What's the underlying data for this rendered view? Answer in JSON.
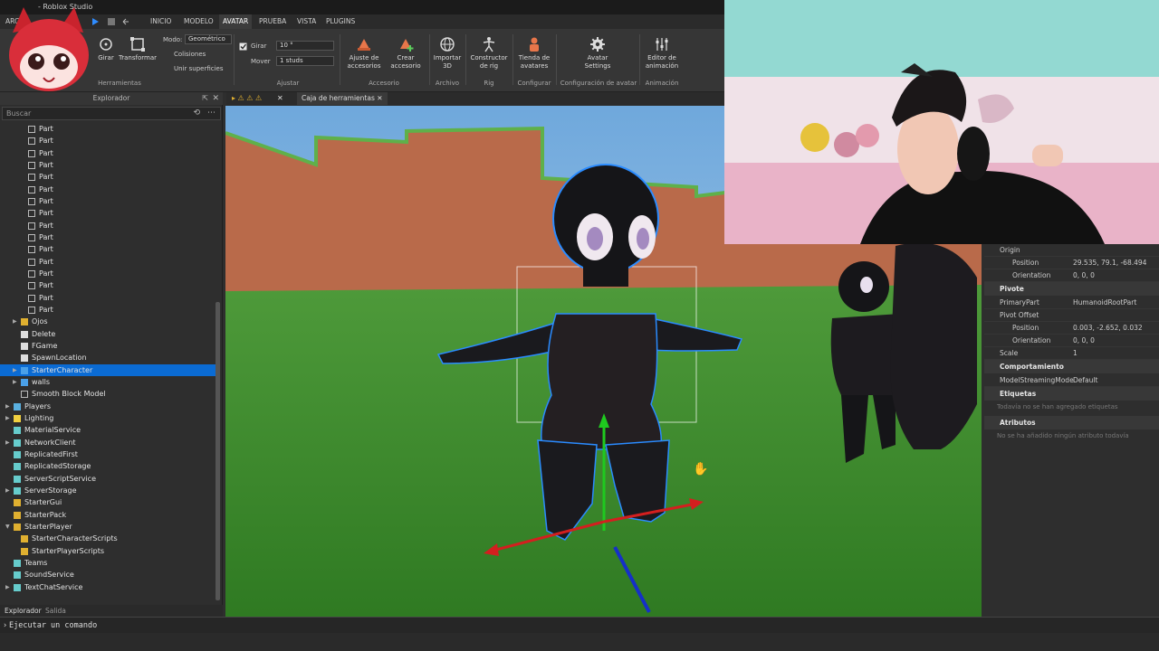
{
  "titlebar": {
    "title": "- Roblox Studio"
  },
  "menubar": {
    "tabs": [
      "ARC",
      "INICIO",
      "MODELO",
      "AVATAR",
      "PRUEBA",
      "VISTA",
      "PLUGINS"
    ]
  },
  "ribbon": {
    "girar": "Girar",
    "transformar": "Transformar",
    "herramientas": "Herramientas",
    "modo_label": "Modo:",
    "modo_value": "Geométrico",
    "colisiones": "Colisiones",
    "unir": "Unir superficies",
    "girar_chk": "Girar",
    "girar_val": "10 °",
    "mover": "Mover",
    "mover_val": "1 studs",
    "ajustar": "Ajustar",
    "ajuste_acc": "Ajuste de accesorios",
    "crear_acc": "Crear accesorio",
    "accesorio": "Accesorio",
    "importar": "Importar 3D",
    "archivo": "Archivo",
    "constructor": "Constructor de rig",
    "rig": "Rig",
    "tienda": "Tienda de avatares",
    "configurar": "Configurar",
    "avatar_settings": "Avatar Settings",
    "config_avatar": "Configuración de avatar",
    "editor": "Editor de animación",
    "animacion": "Animación"
  },
  "explorer": {
    "header": "Explorador",
    "search_placeholder": "Buscar",
    "items": [
      {
        "label": "Part",
        "indent": 2,
        "icon": "part"
      },
      {
        "label": "Part",
        "indent": 2,
        "icon": "part"
      },
      {
        "label": "Part",
        "indent": 2,
        "icon": "part"
      },
      {
        "label": "Part",
        "indent": 2,
        "icon": "part"
      },
      {
        "label": "Part",
        "indent": 2,
        "icon": "part"
      },
      {
        "label": "Part",
        "indent": 2,
        "icon": "part"
      },
      {
        "label": "Part",
        "indent": 2,
        "icon": "part"
      },
      {
        "label": "Part",
        "indent": 2,
        "icon": "part"
      },
      {
        "label": "Part",
        "indent": 2,
        "icon": "part"
      },
      {
        "label": "Part",
        "indent": 2,
        "icon": "part"
      },
      {
        "label": "Part",
        "indent": 2,
        "icon": "part"
      },
      {
        "label": "Part",
        "indent": 2,
        "icon": "part"
      },
      {
        "label": "Part",
        "indent": 2,
        "icon": "part"
      },
      {
        "label": "Part",
        "indent": 2,
        "icon": "part"
      },
      {
        "label": "Part",
        "indent": 2,
        "icon": "part"
      },
      {
        "label": "Part",
        "indent": 2,
        "icon": "part"
      },
      {
        "label": "Ojos",
        "indent": 1,
        "icon": "folder",
        "arrow": true
      },
      {
        "label": "Delete",
        "indent": 1,
        "icon": "script"
      },
      {
        "label": "FGame",
        "indent": 1,
        "icon": "script"
      },
      {
        "label": "SpawnLocation",
        "indent": 1,
        "icon": "spawn"
      },
      {
        "label": "StarterCharacter",
        "indent": 1,
        "icon": "model",
        "arrow": true,
        "selected": true
      },
      {
        "label": "walls",
        "indent": 1,
        "icon": "model",
        "arrow": true
      },
      {
        "label": "Smooth Block Model",
        "indent": 1,
        "icon": "part"
      },
      {
        "label": "Players",
        "indent": 0,
        "icon": "players",
        "arrow": true
      },
      {
        "label": "Lighting",
        "indent": 0,
        "icon": "light",
        "arrow": true
      },
      {
        "label": "MaterialService",
        "indent": 0,
        "icon": "service"
      },
      {
        "label": "NetworkClient",
        "indent": 0,
        "icon": "service",
        "arrow": true
      },
      {
        "label": "ReplicatedFirst",
        "indent": 0,
        "icon": "service"
      },
      {
        "label": "ReplicatedStorage",
        "indent": 0,
        "icon": "service"
      },
      {
        "label": "ServerScriptService",
        "indent": 0,
        "icon": "service"
      },
      {
        "label": "ServerStorage",
        "indent": 0,
        "icon": "service",
        "arrow": true
      },
      {
        "label": "StarterGui",
        "indent": 0,
        "icon": "folder"
      },
      {
        "label": "StarterPack",
        "indent": 0,
        "icon": "folder"
      },
      {
        "label": "StarterPlayer",
        "indent": 0,
        "icon": "folder",
        "arrow": true,
        "open": true
      },
      {
        "label": "StarterCharacterScripts",
        "indent": 1,
        "icon": "folder"
      },
      {
        "label": "StarterPlayerScripts",
        "indent": 1,
        "icon": "folder"
      },
      {
        "label": "Teams",
        "indent": 0,
        "icon": "service"
      },
      {
        "label": "SoundService",
        "indent": 0,
        "icon": "service"
      },
      {
        "label": "TextChatService",
        "indent": 0,
        "icon": "service",
        "arrow": true
      }
    ],
    "tabs": [
      "Explorador",
      "Salida"
    ]
  },
  "viewport": {
    "tab_label": "Caja de herramientas"
  },
  "properties": {
    "rows": [
      {
        "type": "row",
        "k": "Origin",
        "v": "",
        "indent": 0
      },
      {
        "type": "row",
        "k": "Position",
        "v": "29.535, 79.1, -68.494",
        "indent": 1
      },
      {
        "type": "row",
        "k": "Orientation",
        "v": "0, 0, 0",
        "indent": 1
      },
      {
        "type": "head",
        "k": "Pivote"
      },
      {
        "type": "row",
        "k": "PrimaryPart",
        "v": "HumanoidRootPart",
        "indent": 0
      },
      {
        "type": "row",
        "k": "Pivot Offset",
        "v": "",
        "indent": 0
      },
      {
        "type": "row",
        "k": "Position",
        "v": "0.003, -2.652, 0.032",
        "indent": 1
      },
      {
        "type": "row",
        "k": "Orientation",
        "v": "0, 0, 0",
        "indent": 1
      },
      {
        "type": "row",
        "k": "Scale",
        "v": "1",
        "indent": 0
      },
      {
        "type": "head",
        "k": "Comportamiento"
      },
      {
        "type": "row",
        "k": "ModelStreamingMode",
        "v": "Default",
        "indent": 0
      },
      {
        "type": "head",
        "k": "Etiquetas"
      },
      {
        "type": "hint",
        "k": "Todavía no se han agregado etiquetas"
      },
      {
        "type": "head",
        "k": "Atributos"
      },
      {
        "type": "hint",
        "k": "No se ha añadido ningún atributo todavía"
      }
    ]
  },
  "command": {
    "placeholder": "Ejecutar un comando"
  },
  "colors": {
    "selection": "#0b6bd3",
    "accent": "#e8764a"
  }
}
